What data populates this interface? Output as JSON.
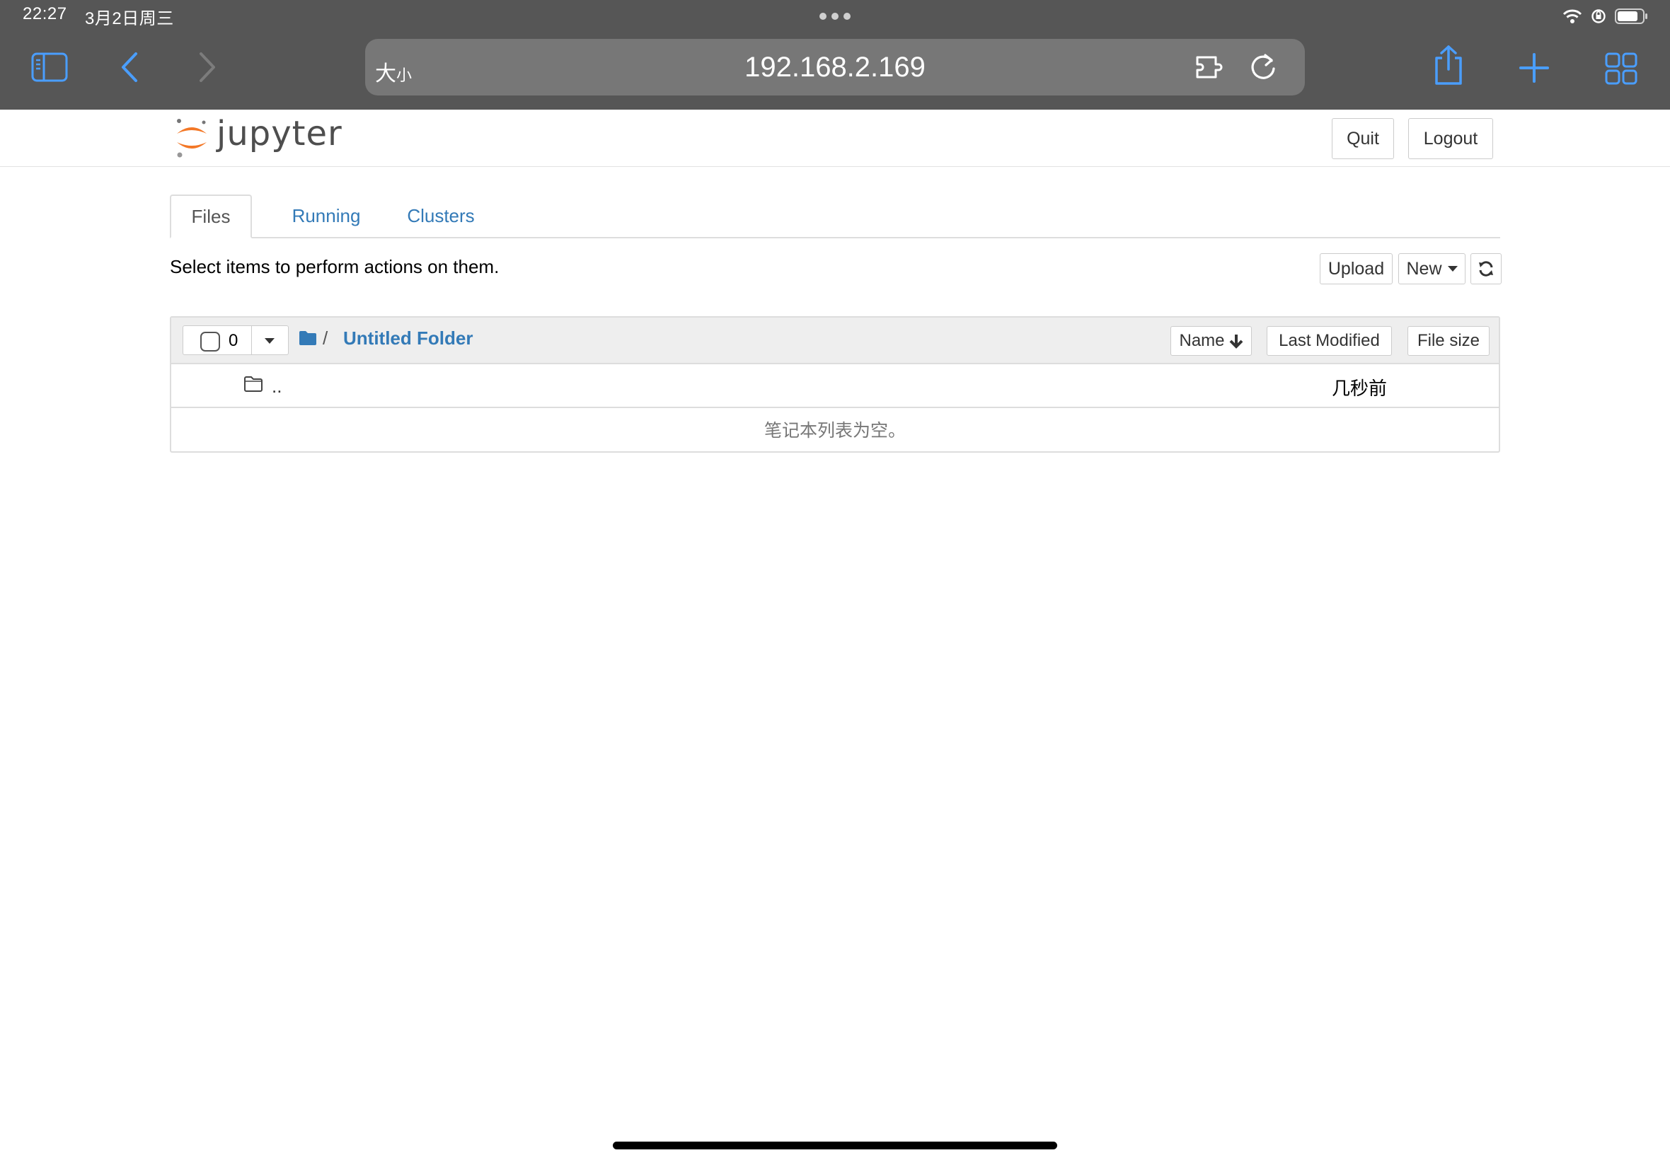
{
  "status_bar": {
    "time": "22:27",
    "date": "3月2日周三"
  },
  "safari": {
    "text_size_label": "大",
    "text_size_small": "小",
    "url": "192.168.2.169",
    "icons": [
      "sidebar-icon",
      "back-icon",
      "forward-icon",
      "extension-icon",
      "reload-icon",
      "share-icon",
      "new-tab-icon",
      "tab-overview-icon"
    ]
  },
  "jupyter_header": {
    "logo_text": "jupyter",
    "quit_label": "Quit",
    "logout_label": "Logout"
  },
  "tabs": [
    {
      "label": "Files"
    },
    {
      "label": "Running"
    },
    {
      "label": "Clusters"
    }
  ],
  "toolbar": {
    "hint": "Select items to perform actions on them.",
    "upload_label": "Upload",
    "new_label": "New"
  },
  "file_list": {
    "selected_count": "0",
    "breadcrumb_separator": "/",
    "current_folder": "Untitled Folder",
    "sort_name_label": "Name",
    "sort_modified_label": "Last Modified",
    "sort_size_label": "File size",
    "parent_dir_label": "..",
    "parent_dir_modified": "几秒前",
    "empty_message": "笔记本列表为空。"
  },
  "colors": {
    "safari_chrome": "#565656",
    "link_blue": "#337ab7",
    "safari_accent": "#4a9eff",
    "jupyter_orange": "#f37726"
  }
}
